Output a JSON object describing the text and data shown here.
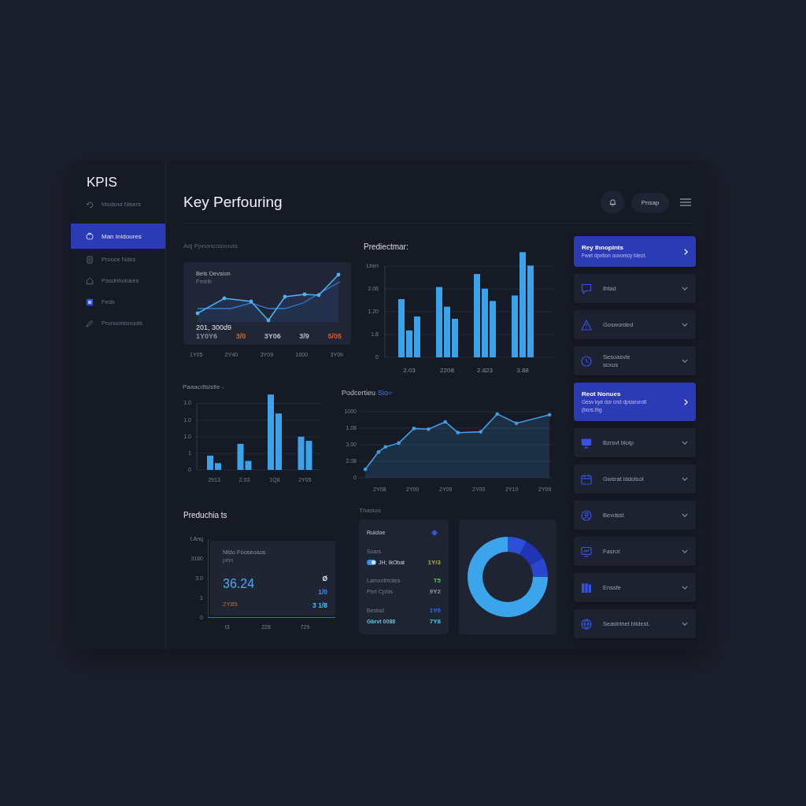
{
  "sidebar": {
    "title": "KPIS",
    "items": [
      {
        "label": "Modsnd Nisers",
        "selected": false
      },
      {
        "label": "Man Inidoures",
        "selected": true
      },
      {
        "label": "Prooce Ndes",
        "selected": false
      },
      {
        "label": "Pasdnhotokes",
        "selected": false
      },
      {
        "label": "Feds",
        "selected": false
      },
      {
        "label": "Pronoonisnoots",
        "selected": false
      }
    ]
  },
  "header": {
    "title": "Key Perfouring",
    "action": "Pnsap"
  },
  "overview": {
    "title": "Adj Ppnoncosnouts",
    "card_title": "Bels Devsion",
    "card_subtitle": "Pmelb",
    "total": "201, 300d9",
    "figures": [
      {
        "text": "1Y0Y6",
        "color": "#8a90a0"
      },
      {
        "text": "3/0",
        "color": "#d2662f"
      },
      {
        "text": "3Y06",
        "color": "#b4b9c6"
      },
      {
        "text": "3/9",
        "color": "#b4b9c6"
      },
      {
        "text": "5/05",
        "color": "#e2552a"
      }
    ],
    "axis_labels": [
      "1Y05",
      "2Y40",
      "3Y09",
      "1000",
      "3Y09"
    ]
  },
  "production_bars": {
    "title": "Prediectmar:",
    "y_labels": [
      "Lben",
      "2.08",
      "1.20",
      "1.8",
      "0"
    ],
    "x_labels": [
      "2.03",
      "2208",
      "2.823",
      "3.88"
    ]
  },
  "distribution_bars": {
    "title": "Paaacdtsistie -",
    "y_labels": [
      "1.0",
      "1.0",
      "1.0",
      "1",
      "0"
    ],
    "x_labels": [
      "2913",
      "2.03",
      "1Q8",
      "2Y05"
    ]
  },
  "trend": {
    "title": "Podcertieu",
    "title_tag": "Sio=",
    "y_labels": [
      "1000",
      "1.08",
      "3.00",
      "2.08",
      "0"
    ],
    "x_labels": [
      "2Y08",
      "2Y00",
      "2Y09",
      "2Y00",
      "2Y10",
      "2Y09"
    ]
  },
  "predictions": {
    "title": "Preduchia ts",
    "y_labels": [
      "t.Anq",
      "3160",
      "3.0",
      "1",
      "0"
    ],
    "x_labels": [
      "t3",
      "228",
      "729"
    ],
    "card": {
      "title": "Ntdo Fooseosos",
      "subtitle": "pinn",
      "value": "36.24",
      "change": "2Y85",
      "side": [
        {
          "text": "Ø",
          "color": "#e4e6ee"
        },
        {
          "text": "1/0",
          "color": "#3f86f0"
        },
        {
          "text": "3 1/8",
          "color": "#45bcf0"
        }
      ]
    }
  },
  "summary": {
    "label": "Thasios",
    "sections": [
      {
        "rows": [
          {
            "kind": "title",
            "label": "Ruicloe"
          }
        ]
      },
      {
        "rows": [
          {
            "kind": "caption",
            "label": "Soars"
          },
          {
            "kind": "switch",
            "label": "JH; IkObat",
            "value": "1Y/3",
            "color": "#a4b050",
            "on": true
          }
        ]
      },
      {
        "rows": [
          {
            "kind": "stat",
            "label": "Lamonthtotes",
            "value": "T5",
            "color": "#4cc070"
          },
          {
            "kind": "stat",
            "label": "Pbrt Cphts",
            "value": "9Y2",
            "color": "#9096a6"
          }
        ]
      },
      {
        "rows": [
          {
            "kind": "stat",
            "label": "Bestad",
            "value": "1Y0",
            "color": "#3a6af0"
          },
          {
            "kind": "total",
            "label": "Gbrvt 0088",
            "value": "7Y8",
            "color": "#44cce4"
          }
        ]
      }
    ]
  },
  "panel": {
    "items": [
      {
        "title": "Rey Ihnopints",
        "subtitle": "Fwet dpxtion ouvonicy bleot.",
        "selected": true
      },
      {
        "title": "Ibtad",
        "selected": false
      },
      {
        "title": "Gosworded",
        "selected": false
      },
      {
        "title": "Sesoasvle\nscxos",
        "selected": false
      },
      {
        "title": "Reot Nonues",
        "subtitle": "Gesv kye dor cnd dpsseurotl\n(bors.thg",
        "selected": true
      },
      {
        "title": "Bzrsvt blotp",
        "selected": false
      },
      {
        "title": "Gwsrat iddolsot",
        "selected": false
      },
      {
        "title": "Bevdsst",
        "selected": false
      },
      {
        "title": "Fasrot",
        "selected": false
      },
      {
        "title": "Enssfe",
        "selected": false
      },
      {
        "title": "Seastrinet blidest.",
        "selected": false
      }
    ]
  }
}
